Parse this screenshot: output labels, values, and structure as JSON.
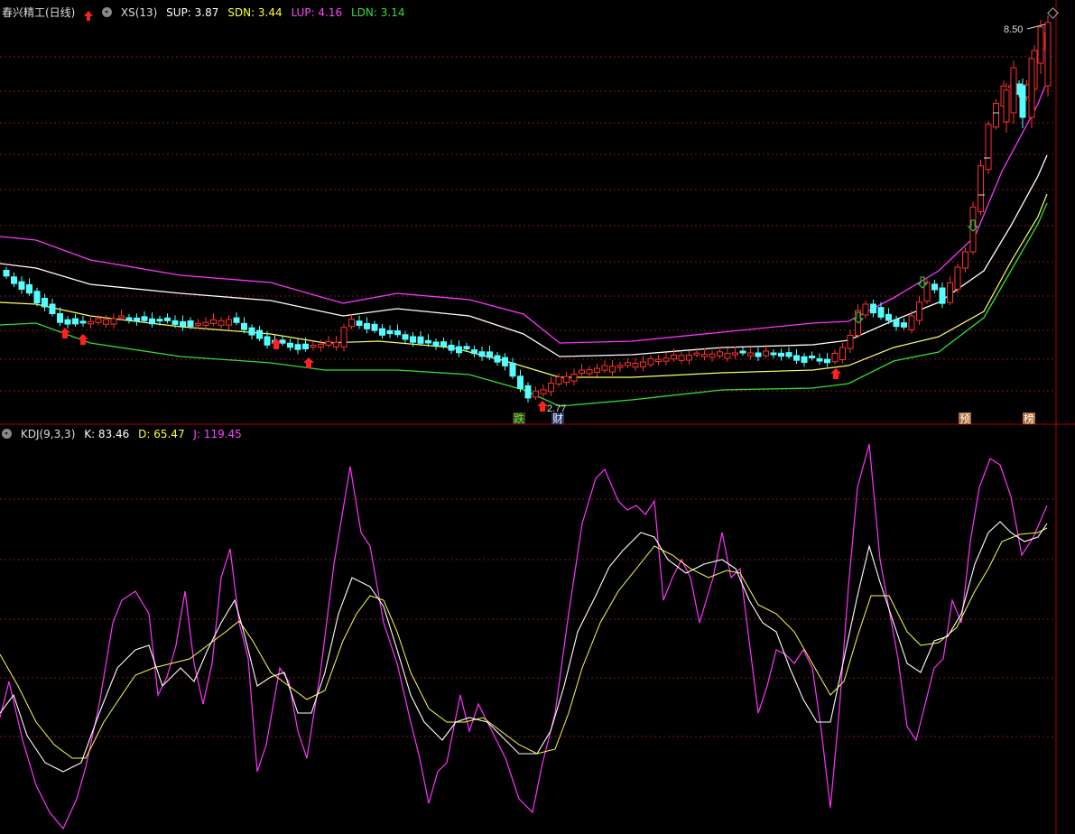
{
  "main_panel": {
    "stock_name": "春兴精工(日线)",
    "indicator_name": "XS(13)",
    "sup": {
      "label": "SUP: 3.87",
      "color": "#ffffff"
    },
    "sdn": {
      "label": "SDN: 3.44",
      "color": "#ffff33"
    },
    "lup": {
      "label": "LUP: 4.16",
      "color": "#ff33ff"
    },
    "ldn": {
      "label": "LDN: 3.14",
      "color": "#33dd33"
    },
    "high_label": "8.50",
    "low_label": "2.77",
    "event_labels": [
      {
        "text": "跌",
        "color": "#33ff33",
        "bg": "#553322"
      },
      {
        "text": "财",
        "color": "#ffffff",
        "bg": "#223366"
      },
      {
        "text": "预",
        "color": "#ffffff",
        "bg": "#aa6633"
      },
      {
        "text": "榜",
        "color": "#ffffff",
        "bg": "#aa6633"
      }
    ]
  },
  "kdj_panel": {
    "name": "KDJ(9,3,3)",
    "k": {
      "label": "K: 83.46",
      "color": "#ffffff"
    },
    "d": {
      "label": "D: 65.47",
      "color": "#ffff33"
    },
    "j": {
      "label": "J: 119.45",
      "color": "#ff33ff"
    }
  },
  "colors": {
    "up": "#ff3030",
    "down": "#55ffff",
    "grid": "#7a1a1a",
    "divider": "#b00000"
  }
}
